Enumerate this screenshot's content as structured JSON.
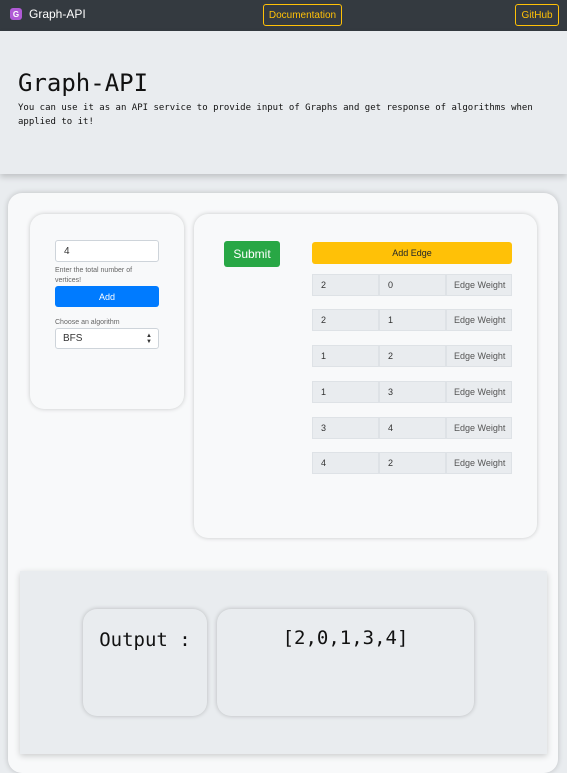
{
  "navbar": {
    "logo_letter": "G",
    "brand": "Graph-API",
    "docs_button": "Documentation",
    "github_button": "GitHub"
  },
  "hero": {
    "title": "Graph-API",
    "description": "You can use it as an API service to provide input of Graphs and get response of algorithms when applied to it!"
  },
  "config": {
    "vertices_value": "4",
    "vertices_label": "Enter the total number of vertices!",
    "add_button": "Add",
    "algorithm_label": "Choose an algorithm",
    "algorithm_value": "BFS"
  },
  "edges_panel": {
    "submit_button": "Submit",
    "add_edge_button": "Add Edge",
    "weight_placeholder": "Edge Weight",
    "edges": [
      {
        "from": "2",
        "to": "0"
      },
      {
        "from": "2",
        "to": "1"
      },
      {
        "from": "1",
        "to": "2"
      },
      {
        "from": "1",
        "to": "3"
      },
      {
        "from": "3",
        "to": "4"
      },
      {
        "from": "4",
        "to": "2"
      }
    ]
  },
  "output": {
    "label": "Output :",
    "result": "[2,0,1,3,4]"
  },
  "colors": {
    "navbar": "#343a40",
    "accent_yellow": "#ffc107",
    "primary_blue": "#007bff",
    "success_green": "#28a745",
    "logo_purple": "#b05ad6"
  }
}
